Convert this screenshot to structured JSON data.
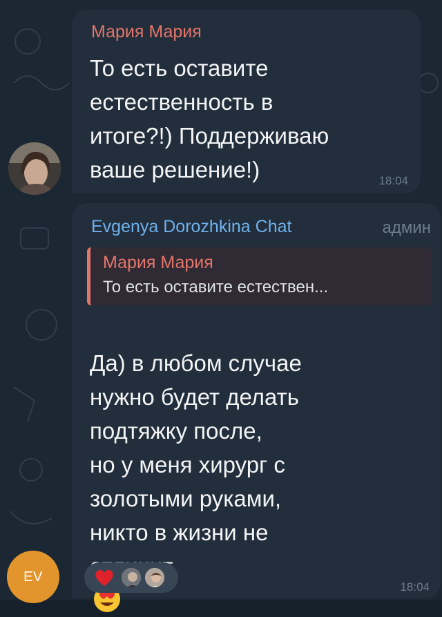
{
  "messages": [
    {
      "sender": "Мария Мария",
      "text": "То есть оставите\nестественность в\nитоге?!) Поддерживаю\nваше решение!)",
      "time": "18:04"
    },
    {
      "sender": "Evgenya Dorozhkina Chat",
      "sender_role": "админ",
      "reply_to": {
        "sender": "Мария Мария",
        "text": "То есть оставите естествен..."
      },
      "text": "Да) в любом случае\nнужно будет делать\nподтяжку после,\nно у меня хирург с\nзолотыми руками,\nникто в жизни не\nотличит",
      "emoji": "heart-eyes-emoji",
      "reaction": {
        "emoji": "heart-icon"
      },
      "time": "18:04",
      "avatar_initials": "EV"
    }
  ],
  "colors": {
    "background": "#1b2733",
    "bubble": "#222e3b",
    "name_red": "#e4766b",
    "name_blue": "#6fb1ec",
    "muted": "#6d7d8d",
    "avatar_orange": "#e2952c"
  }
}
